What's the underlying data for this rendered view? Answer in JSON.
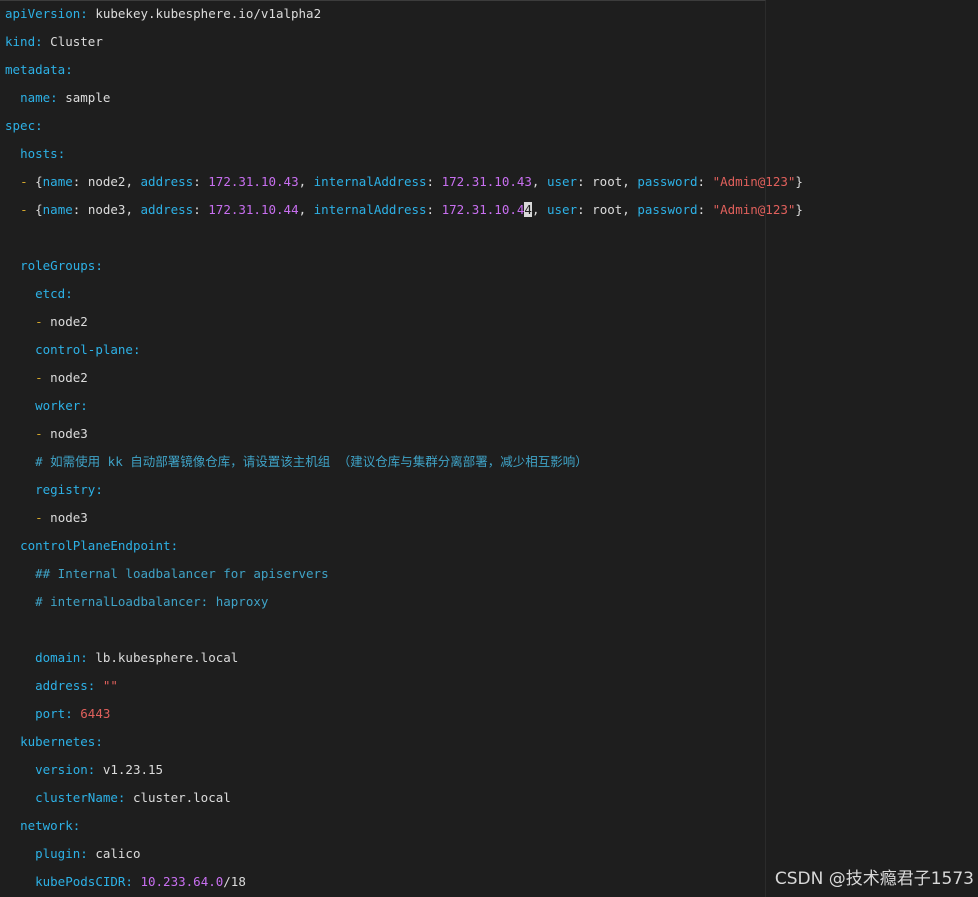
{
  "code_lines": [
    "apiVersion: kubekey.kubesphere.io/v1alpha2",
    "kind: Cluster",
    "metadata:",
    "  name: sample",
    "spec:",
    "  hosts:",
    "  - {name: node2, address: 172.31.10.43, internalAddress: 172.31.10.43, user: root, password: \"Admin@123\"}",
    "  - {name: node3, address: 172.31.10.44, internalAddress: 172.31.10.44, user: root, password: \"Admin@123\"}",
    "",
    "  roleGroups:",
    "    etcd:",
    "    - node2",
    "    control-plane:",
    "    - node2",
    "    worker:",
    "    - node3",
    "    # 如需使用 kk 自动部署镜像仓库，请设置该主机组 （建议仓库与集群分离部署，减少相互影响）",
    "    registry:",
    "    - node3",
    "  controlPlaneEndpoint:",
    "    ## Internal loadbalancer for apiservers",
    "    # internalLoadbalancer: haproxy",
    "",
    "    domain: lb.kubesphere.local",
    "    address: \"\"",
    "    port: 6443",
    "  kubernetes:",
    "    version: v1.23.15",
    "    clusterName: cluster.local",
    "  network:",
    "    plugin: calico",
    "    kubePodsCIDR: 10.233.64.0/18"
  ],
  "colors": {
    "background": "#1e1e1e",
    "key": "#2db1e6",
    "value": "#dcdcdc",
    "dash": "#d4a72c",
    "number": "#c86ff0",
    "string": "#e0605c",
    "comment": "#3fa3c7"
  },
  "watermark": "CSDN @技术瘾君子1573"
}
